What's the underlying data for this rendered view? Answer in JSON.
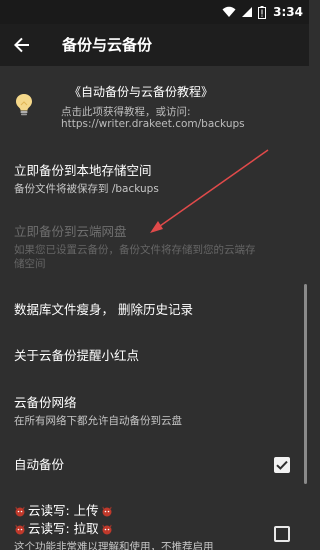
{
  "status_bar": {
    "time": "3:34"
  },
  "app_bar": {
    "title": "备份与云备份"
  },
  "tip": {
    "title": "《自动备份与云备份教程》",
    "subtitle": "点击此项获得教程，或访问:",
    "url": "https://writer.drakeet.com/backups"
  },
  "items": {
    "local_backup": {
      "title": "立即备份到本地存储空间",
      "subtitle": "备份文件将被保存到 /backups"
    },
    "cloud_backup": {
      "title": "立即备份到云端网盘",
      "subtitle_line1": "如果您已设置云备份，备份文件将存储到您的云端存",
      "subtitle_line2": "储空间"
    },
    "slim_db": {
      "title": "数据库文件瘦身， 删除历史记录"
    },
    "red_dot": {
      "title": "关于云备份提醒小红点"
    },
    "cloud_network": {
      "title": "云备份网络",
      "subtitle": "在所有网络下都允许自动备份到云盘"
    },
    "auto_backup": {
      "title": "自动备份",
      "checked": true
    },
    "cloud_rw": {
      "line1": "云读写: 上传",
      "line2": "云读写: 拉取",
      "subtitle": "这个功能非常难以理解和使用，不推荐启用",
      "checked": false
    }
  },
  "colors": {
    "background": "#2f2f2f",
    "app_bar": "#1e1e1e",
    "arrow": "#e04a4a",
    "demon": "#c0392b"
  },
  "icons": [
    "back-arrow-icon",
    "lightbulb-icon",
    "wifi-icon",
    "signal-icon",
    "battery-icon",
    "check-icon",
    "demon-icon"
  ]
}
